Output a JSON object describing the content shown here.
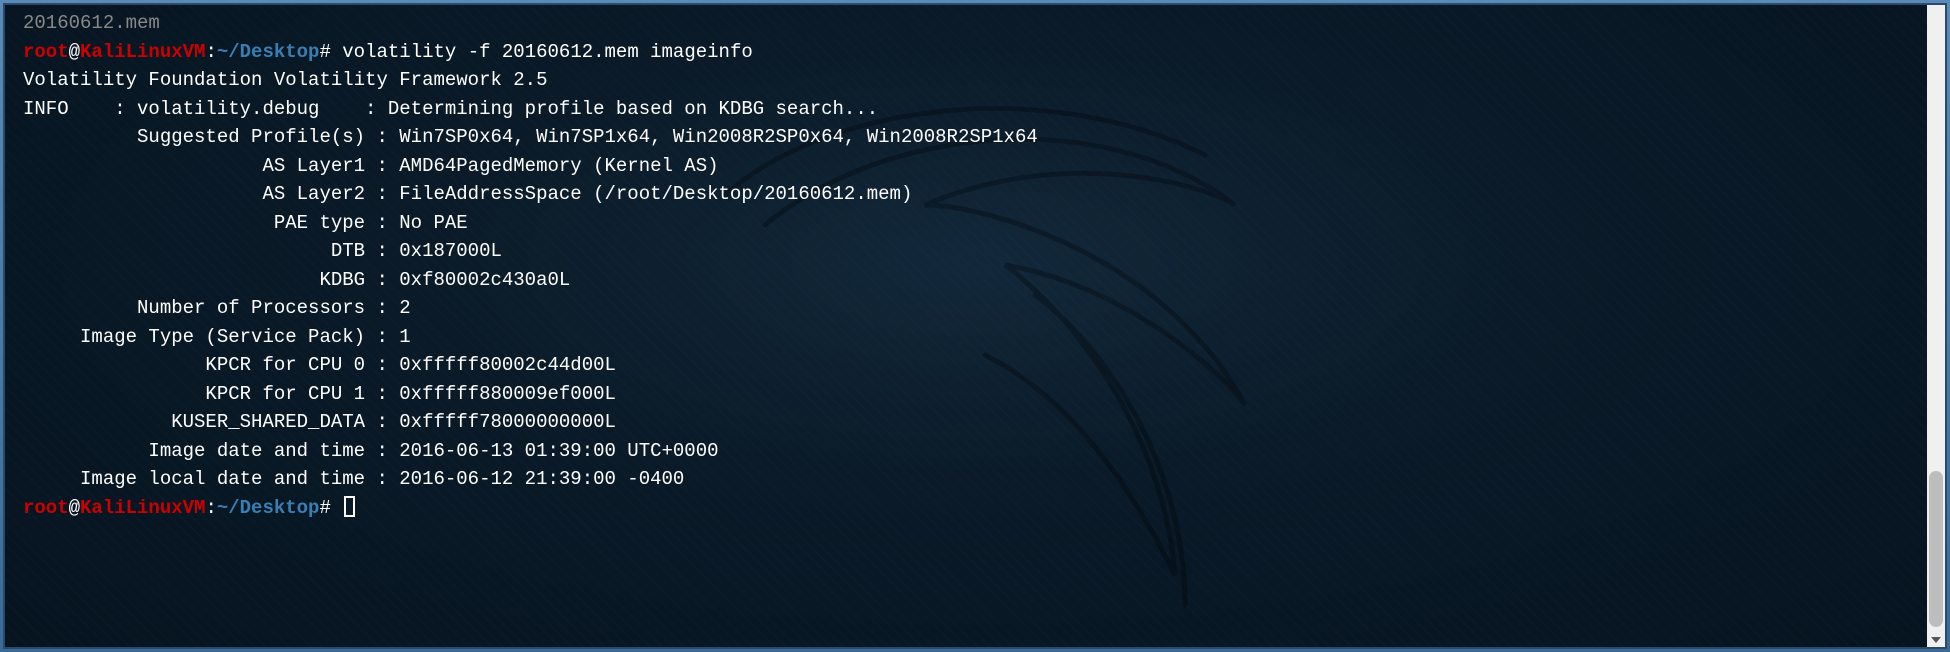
{
  "prompt": {
    "user": "root",
    "at": "@",
    "host": "KaliLinuxVM",
    "colon": ":",
    "cwd": "~/Desktop",
    "symbol": "#"
  },
  "truncated_top": "20160612.mem",
  "command": "volatility -f 20160612.mem imageinfo",
  "header_line": "Volatility Foundation Volatility Framework 2.5",
  "info_line": "INFO    : volatility.debug    : Determining profile based on KDBG search...",
  "fields": [
    {
      "label": "          Suggested Profile(s)",
      "value": "Win7SP0x64, Win7SP1x64, Win2008R2SP0x64, Win2008R2SP1x64"
    },
    {
      "label": "                     AS Layer1",
      "value": "AMD64PagedMemory (Kernel AS)"
    },
    {
      "label": "                     AS Layer2",
      "value": "FileAddressSpace (/root/Desktop/20160612.mem)"
    },
    {
      "label": "                      PAE type",
      "value": "No PAE"
    },
    {
      "label": "                           DTB",
      "value": "0x187000L"
    },
    {
      "label": "                          KDBG",
      "value": "0xf80002c430a0L"
    },
    {
      "label": "          Number of Processors",
      "value": "2"
    },
    {
      "label": "     Image Type (Service Pack)",
      "value": "1"
    },
    {
      "label": "                KPCR for CPU 0",
      "value": "0xfffff80002c44d00L"
    },
    {
      "label": "                KPCR for CPU 1",
      "value": "0xfffff880009ef000L"
    },
    {
      "label": "             KUSER_SHARED_DATA",
      "value": "0xfffff78000000000L"
    },
    {
      "label": "           Image date and time",
      "value": "2016-06-13 01:39:00 UTC+0000"
    },
    {
      "label": "     Image local date and time",
      "value": "2016-06-12 21:39:00 -0400"
    }
  ]
}
